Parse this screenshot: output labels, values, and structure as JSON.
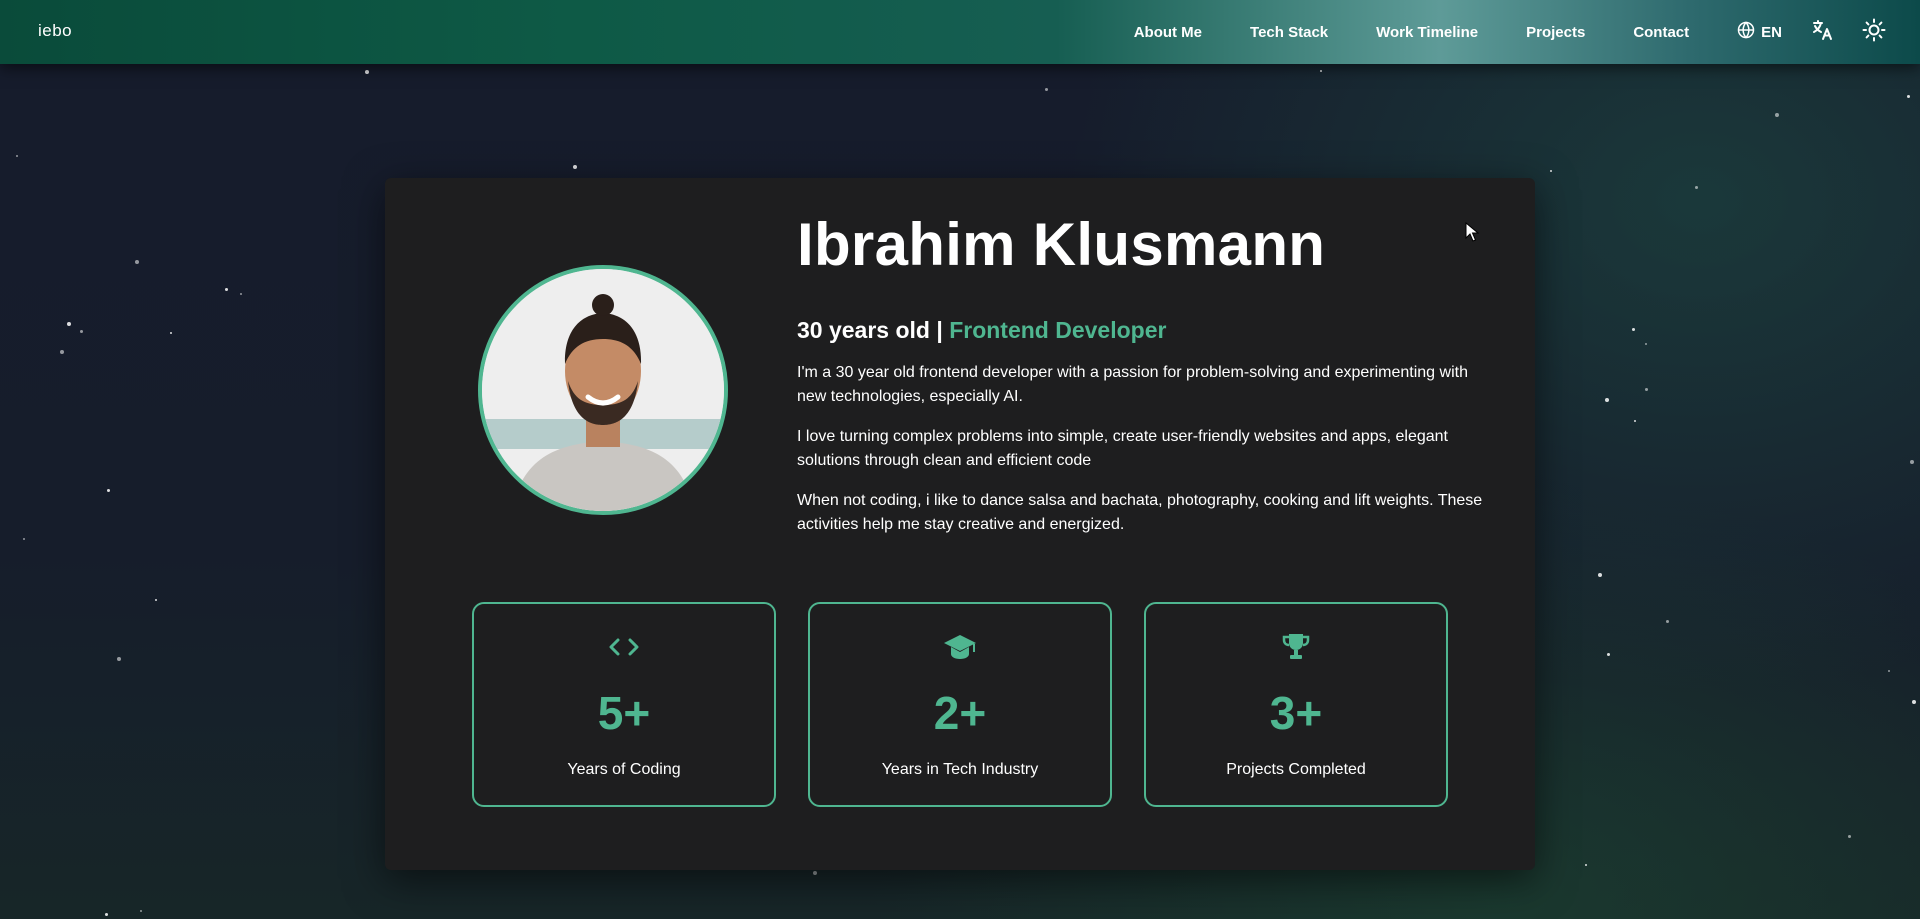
{
  "header": {
    "logo": "iebo",
    "nav": [
      {
        "label": "About Me"
      },
      {
        "label": "Tech Stack"
      },
      {
        "label": "Work Timeline"
      },
      {
        "label": "Projects"
      },
      {
        "label": "Contact"
      }
    ],
    "language": "EN",
    "icons": {
      "language": "globe-icon",
      "translate": "translate-icon",
      "theme": "sun-icon"
    }
  },
  "profile": {
    "name": "Ibrahim Klusmann",
    "age_text": "30 years old |",
    "role": "Frontend Developer",
    "bio": [
      "I'm a 30 year old frontend developer with a passion for problem-solving and experimenting with new technologies, especially AI.",
      "I love turning complex problems into simple, create user-friendly websites and apps, elegant solutions through clean and efficient code",
      "When not coding, i like to dance salsa and bachata, photography, cooking and lift weights. These activities help me stay creative and energized."
    ]
  },
  "stats": [
    {
      "icon": "code-icon",
      "value": "5+",
      "label": "Years of Coding"
    },
    {
      "icon": "graduation-cap-icon",
      "value": "2+",
      "label": "Years in Tech Industry"
    },
    {
      "icon": "trophy-icon",
      "value": "3+",
      "label": "Projects Completed"
    }
  ],
  "colors": {
    "accent": "#4fb690",
    "card_bg": "#1e1e1f",
    "page_bg": "#161c2c",
    "header_start": "#0a4b3a",
    "header_highlight": "#5e9b98"
  }
}
